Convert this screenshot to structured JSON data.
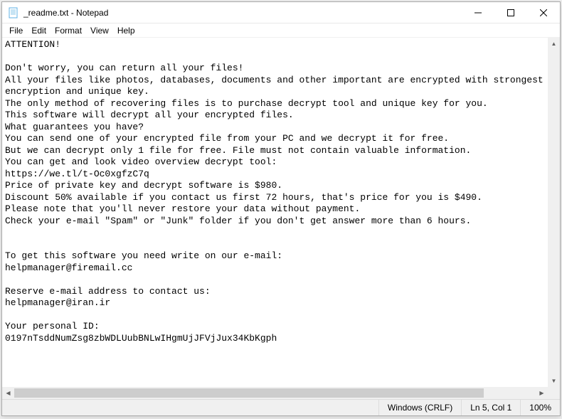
{
  "titlebar": {
    "title": "_readme.txt - Notepad"
  },
  "menubar": {
    "file": "File",
    "edit": "Edit",
    "format": "Format",
    "view": "View",
    "help": "Help"
  },
  "document": {
    "text": "ATTENTION!\n\nDon't worry, you can return all your files!\nAll your files like photos, databases, documents and other important are encrypted with strongest encryption and unique key.\nThe only method of recovering files is to purchase decrypt tool and unique key for you.\nThis software will decrypt all your encrypted files.\nWhat guarantees you have?\nYou can send one of your encrypted file from your PC and we decrypt it for free.\nBut we can decrypt only 1 file for free. File must not contain valuable information.\nYou can get and look video overview decrypt tool:\nhttps://we.tl/t-Oc0xgfzC7q\nPrice of private key and decrypt software is $980.\nDiscount 50% available if you contact us first 72 hours, that's price for you is $490.\nPlease note that you'll never restore your data without payment.\nCheck your e-mail \"Spam\" or \"Junk\" folder if you don't get answer more than 6 hours.\n\n\nTo get this software you need write on our e-mail:\nhelpmanager@firemail.cc\n\nReserve e-mail address to contact us:\nhelpmanager@iran.ir\n\nYour personal ID:\n0197nTsddNumZsg8zbWDLUubBNLwIHgmUjJFVjJux34KbKgph"
  },
  "statusbar": {
    "encoding": "Windows (CRLF)",
    "position": "Ln 5, Col 1",
    "zoom": "100%"
  }
}
